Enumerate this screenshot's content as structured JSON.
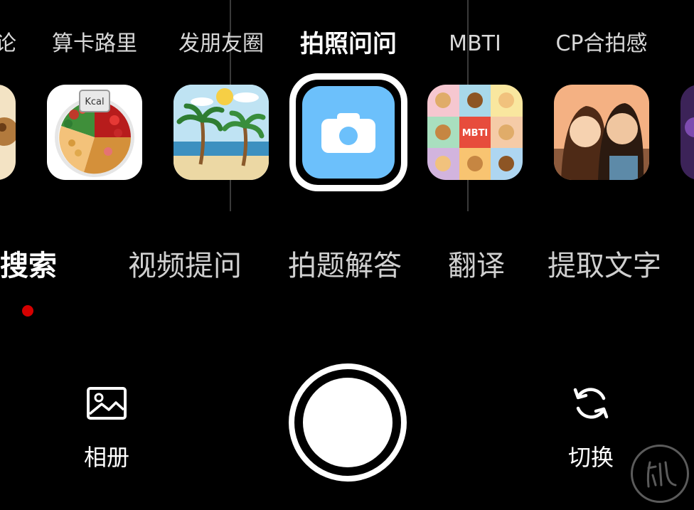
{
  "mode_bar": {
    "items": [
      {
        "label": "论",
        "active": false
      },
      {
        "label": "算卡路里",
        "active": false
      },
      {
        "label": "发朋友圈",
        "active": false
      },
      {
        "label": "拍照问问",
        "active": true
      },
      {
        "label": "MBTI",
        "active": false
      },
      {
        "label": "CP合拍感",
        "active": false
      }
    ]
  },
  "thumbnails": {
    "calorie_text": "Kcal",
    "mbti_text": "MBTI"
  },
  "function_tabs": [
    {
      "label": "照搜索",
      "active": true
    },
    {
      "label": "视频提问",
      "active": false
    },
    {
      "label": "拍题解答",
      "active": false
    },
    {
      "label": "翻译",
      "active": false
    },
    {
      "label": "提取文字",
      "active": false
    }
  ],
  "bottom_bar": {
    "gallery_label": "相册",
    "switch_label": "切换"
  },
  "colors": {
    "background": "#000000",
    "camera_tile": "#6cc0fb",
    "indicator_dot": "#d50000"
  },
  "icons": [
    "camera-icon",
    "image-gallery-icon",
    "camera-switch-icon"
  ]
}
